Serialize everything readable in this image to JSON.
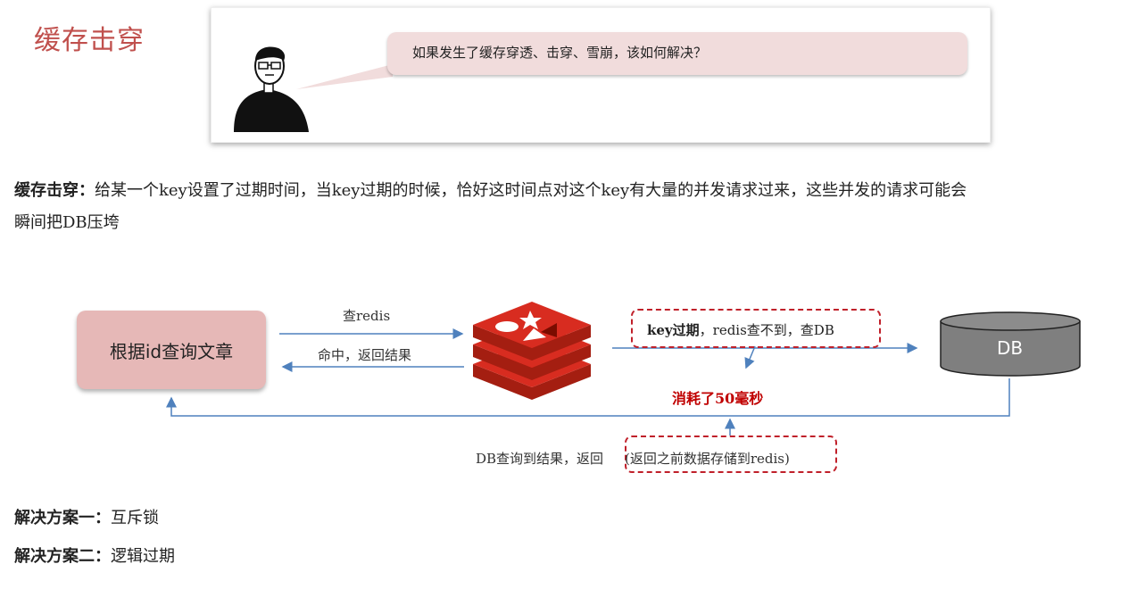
{
  "title": "缓存击穿",
  "bubble": {
    "text": "如果发生了缓存穿透、击穿、雪崩，该如何解决？"
  },
  "definition": {
    "term": "缓存击穿：",
    "text_line1": "给某一个key设置了过期时间，当key过期的时候，恰好这时间点对这个key有大量的并发请求过来，这些并发的请求可能会",
    "text_line2": "瞬间把DB压垮"
  },
  "diagram": {
    "left_box": "根据id查询文章",
    "query_label": "查redis",
    "hit_label": "命中，返回结果",
    "miss_bold": "key过期",
    "miss_rest": "，redis查不到，查DB",
    "cost_label": "消耗了50毫秒",
    "db_label": "DB",
    "return_prefix": "DB查询到结果，返回",
    "return_boxed": "(返回之前数据存储到redis)"
  },
  "solutions": [
    {
      "label": "解决方案一：",
      "text": "互斥锁"
    },
    {
      "label": "解决方案二：",
      "text": "逻辑过期"
    }
  ],
  "colors": {
    "title": "#c0504d",
    "bubble": "#f1dcdc",
    "left_box": "#e6b8b7",
    "arrow": "#4f81bd",
    "dashed": "#c0202a",
    "redis": "#d82c20",
    "db": "#7f7f7f"
  }
}
